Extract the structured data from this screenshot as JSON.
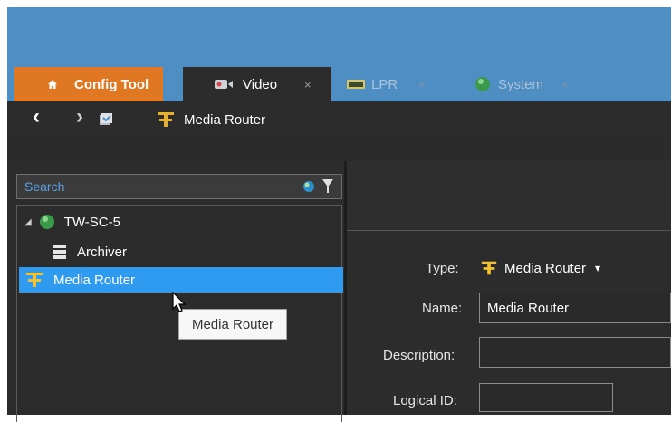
{
  "tabs": {
    "home": {
      "label": "Config Tool"
    },
    "items": [
      {
        "label": "Video",
        "active": true,
        "close": "×"
      },
      {
        "label": "LPR",
        "active": false,
        "close": "×"
      },
      {
        "label": "System",
        "active": false,
        "close": "×"
      }
    ]
  },
  "toolbar": {
    "back_glyph": "‹",
    "forward_glyph": "›",
    "breadcrumb": "Media Router"
  },
  "search": {
    "placeholder": "Search"
  },
  "tree": {
    "root": {
      "label": "TW-SC-5",
      "expand_glyph": "◢"
    },
    "items": [
      {
        "label": "Archiver",
        "icon": "archiver-icon"
      },
      {
        "label": "Media Router",
        "icon": "media-router-icon",
        "selected": true
      }
    ]
  },
  "tooltip": {
    "text": "Media Router"
  },
  "properties": {
    "type_label": "Type:",
    "type_value": "Media Router",
    "type_caret": "▾",
    "name_label": "Name:",
    "name_value": "Media Router",
    "description_label": "Description:",
    "description_value": "",
    "logical_id_label": "Logical ID:",
    "logical_id_value": ""
  },
  "colors": {
    "accent": "#4f8ec2",
    "home_tab": "#e07722",
    "selection": "#2f9bf0",
    "panel": "#2c2c2c"
  }
}
